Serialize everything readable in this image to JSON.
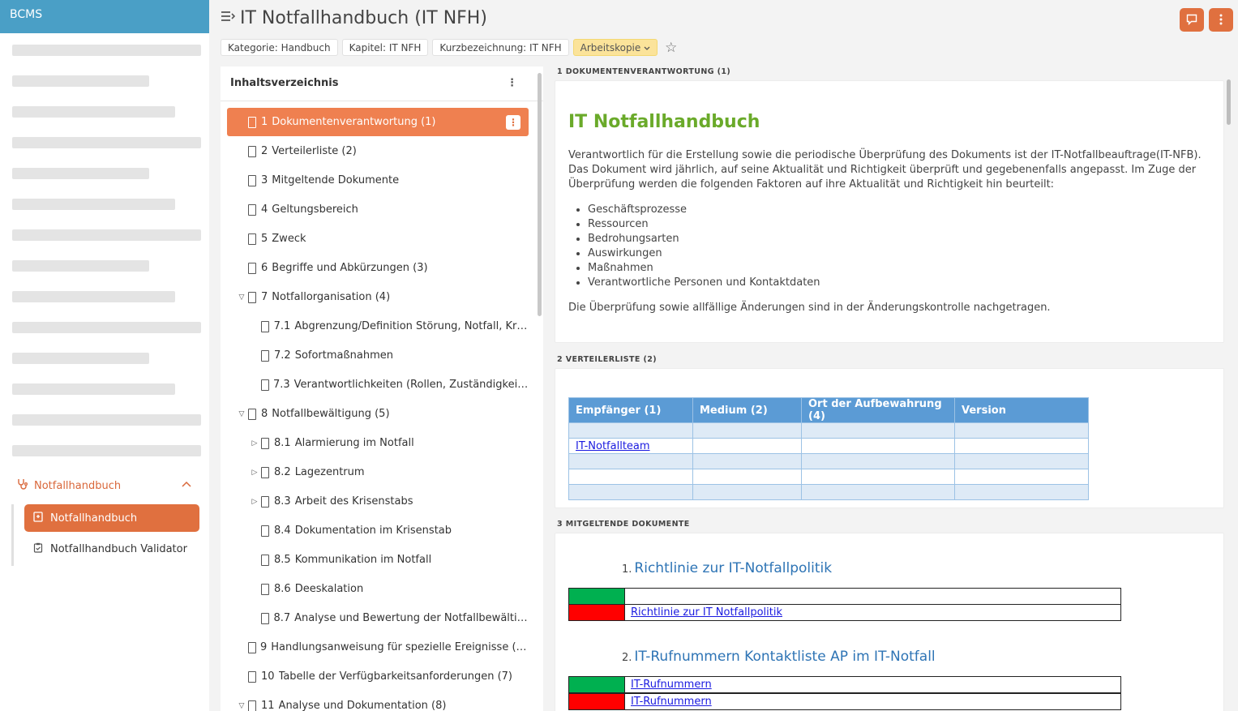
{
  "app": {
    "brand": "BCMS"
  },
  "sidebar": {
    "group": {
      "label": "Notfallhandbuch",
      "icon": "stethoscope-icon"
    },
    "items": [
      {
        "label": "Notfallhandbuch",
        "icon": "notebook-icon",
        "active": true
      },
      {
        "label": "Notfallhandbuch Validator",
        "icon": "clipboard-check-icon",
        "active": false
      }
    ]
  },
  "header": {
    "title": "IT Notfallhandbuch (IT NFH)",
    "tags": {
      "kategorie": "Kategorie: Handbuch",
      "kapitel": "Kapitel: IT NFH",
      "kurz": "Kurzbezeichnung: IT NFH",
      "status": "Arbeitskopie"
    }
  },
  "toc": {
    "title": "Inhaltsverzeichnis",
    "items": [
      {
        "num": "1",
        "label": "Dokumentenverantwortung (1)",
        "active": true,
        "level": 0,
        "toggle": ""
      },
      {
        "num": "2",
        "label": "Verteilerliste (2)",
        "level": 0,
        "toggle": ""
      },
      {
        "num": "3",
        "label": "Mitgeltende Dokumente",
        "level": 0,
        "toggle": ""
      },
      {
        "num": "4",
        "label": "Geltungsbereich",
        "level": 0,
        "toggle": ""
      },
      {
        "num": "5",
        "label": "Zweck",
        "level": 0,
        "toggle": ""
      },
      {
        "num": "6",
        "label": "Begriffe und Abkürzungen (3)",
        "level": 0,
        "toggle": ""
      },
      {
        "num": "7",
        "label": "Notfallorganisation (4)",
        "level": 0,
        "toggle": "expanded"
      },
      {
        "num": "7.1",
        "label": "Abgrenzung/Definition Störung, Notfall, Krise",
        "level": 1,
        "toggle": ""
      },
      {
        "num": "7.2",
        "label": "Sofortmaßnahmen",
        "level": 1,
        "toggle": ""
      },
      {
        "num": "7.3",
        "label": "Verantwortlichkeiten (Rollen, Zuständigkeite...",
        "level": 1,
        "toggle": ""
      },
      {
        "num": "8",
        "label": "Notfallbewältigung (5)",
        "level": 0,
        "toggle": "expanded"
      },
      {
        "num": "8.1",
        "label": "Alarmierung im Notfall",
        "level": 1,
        "toggle": "collapsed"
      },
      {
        "num": "8.2",
        "label": "Lagezentrum",
        "level": 1,
        "toggle": "collapsed"
      },
      {
        "num": "8.3",
        "label": "Arbeit des Krisenstabs",
        "level": 1,
        "toggle": "collapsed"
      },
      {
        "num": "8.4",
        "label": "Dokumentation im Krisenstab",
        "level": 1,
        "toggle": ""
      },
      {
        "num": "8.5",
        "label": "Kommunikation im Notfall",
        "level": 1,
        "toggle": ""
      },
      {
        "num": "8.6",
        "label": "Deeskalation",
        "level": 1,
        "toggle": ""
      },
      {
        "num": "8.7",
        "label": "Analyse und Bewertung der Notfallbewältig...",
        "level": 1,
        "toggle": ""
      },
      {
        "num": "9",
        "label": "Handlungsanweisung für spezielle Ereignisse (So...",
        "level": 0,
        "toggle": ""
      },
      {
        "num": "10",
        "label": "Tabelle der Verfügbarkeitsanforderungen (7)",
        "level": 0,
        "toggle": ""
      },
      {
        "num": "11",
        "label": "Analyse und Dokumentation (8)",
        "level": 0,
        "toggle": "expanded"
      }
    ]
  },
  "content": {
    "sec1": {
      "label": "1 DOKUMENTENVERANTWORTUNG (1)",
      "title": "IT Notfallhandbuch",
      "intro": "Verantwortlich für die Erstellung sowie die periodische Überprüfung des Dokuments ist der IT-Notfallbeauftrage(IT-NFB). Das Dokument wird jährlich, auf seine Aktualität und Richtigkeit überprüft und gegebenenfalls angepasst. Im Zuge der Überprüfung werden die folgenden Faktoren auf ihre Aktualität und Richtigkeit hin beurteilt:",
      "bullets": [
        "Geschäftsprozesse",
        "Ressourcen",
        "Bedrohungsarten",
        "Auswirkungen",
        "Maßnahmen",
        "Verantwortliche Personen und Kontaktdaten"
      ],
      "outro": "Die Überprüfung sowie allfällige Änderungen sind in der Änderungskontrolle nachgetragen."
    },
    "sec2": {
      "label": "2 VERTEILERLISTE (2)",
      "columns": [
        "Empfänger (1)",
        "Medium (2)",
        "Ort der Aufbewahrung (4)",
        "Version"
      ],
      "rows": [
        [
          "",
          "",
          "",
          ""
        ],
        [
          "IT-Notfallteam",
          "",
          "",
          ""
        ],
        [
          "",
          "",
          "",
          ""
        ],
        [
          "",
          "",
          "",
          ""
        ],
        [
          "",
          "",
          "",
          ""
        ]
      ]
    },
    "sec3": {
      "label": "3 MITGELTENDE DOKUMENTE",
      "docs": [
        {
          "n": "1.",
          "title": "Richtlinie zur IT-Notfallpolitik",
          "rows": [
            {
              "color": "#00b050",
              "text": ""
            },
            {
              "color": "#ff0000",
              "text": "Richtlinie zur IT Notfallpolitik"
            }
          ]
        },
        {
          "n": "2.",
          "title": "IT-Rufnummern Kontaktliste AP im IT-Notfall",
          "rows": [
            {
              "color": "#00b050",
              "text": "IT-Rufnummern"
            },
            {
              "color": "#ff0000",
              "text": "IT-Rufnummern"
            }
          ]
        }
      ]
    }
  }
}
